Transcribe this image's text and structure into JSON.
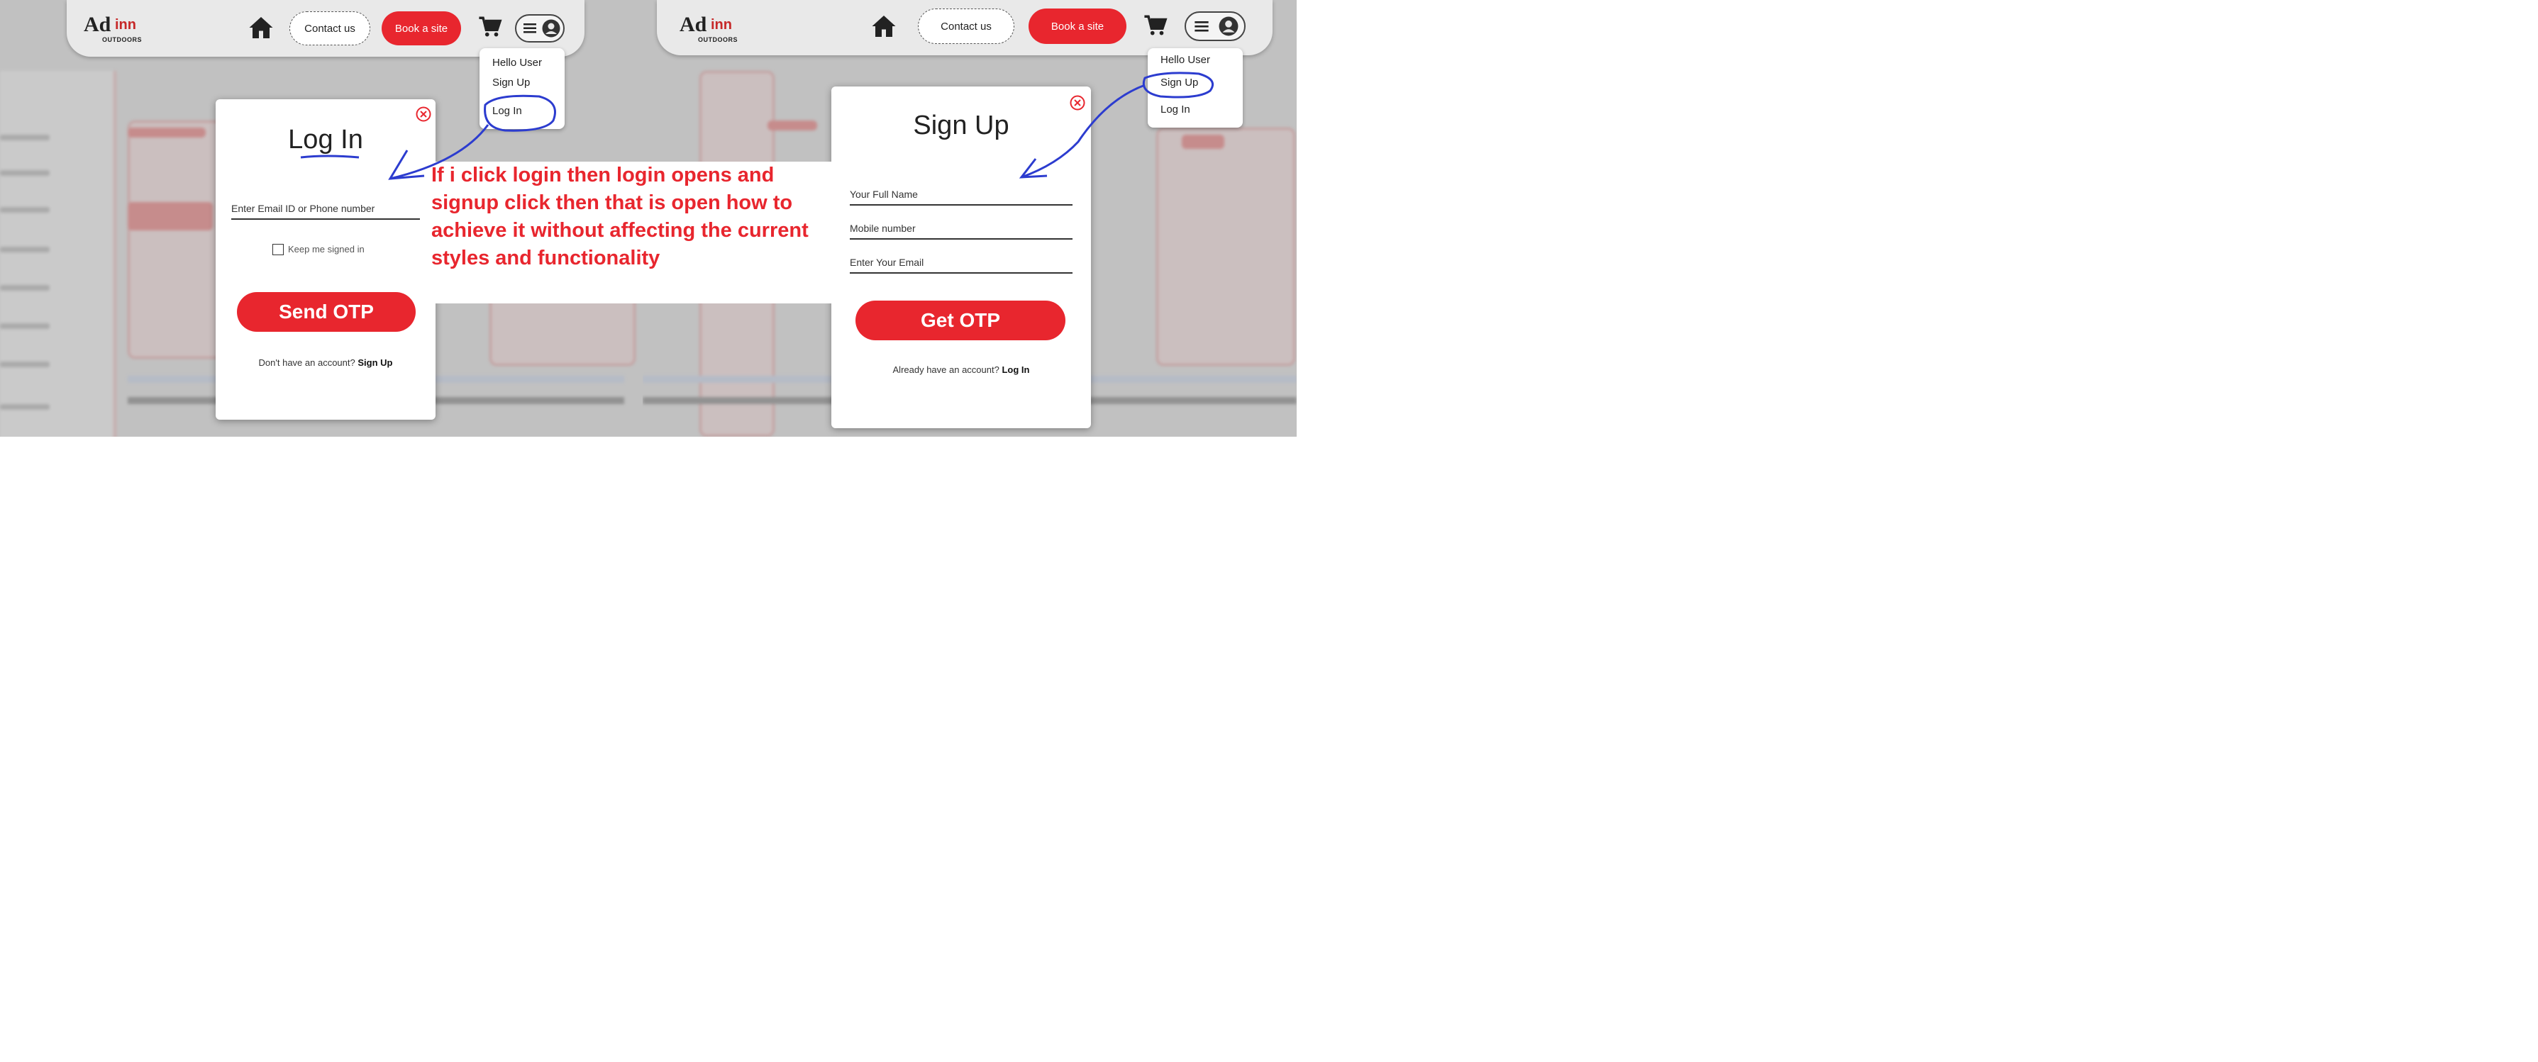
{
  "left_screen": {
    "logo": {
      "ad": "Ad",
      "inn": "inn",
      "sub": "OUTDOORS"
    },
    "nav": {
      "contact_label": "Contact us",
      "book_label": "Book a site"
    },
    "dropdown": {
      "items": [
        "Hello User",
        "Sign Up",
        "Log In"
      ]
    },
    "modal": {
      "title": "Log In",
      "email_placeholder": "Enter Email ID or Phone number",
      "keep_signed_in": "Keep me signed in",
      "submit_label": "Send OTP",
      "footer_text": "Don't have an account?",
      "footer_link": "Sign Up"
    }
  },
  "right_screen": {
    "logo": {
      "ad": "Ad",
      "inn": "inn",
      "sub": "OUTDOORS"
    },
    "nav": {
      "contact_label": "Contact us",
      "book_label": "Book a site"
    },
    "dropdown": {
      "items": [
        "Hello User",
        "Sign Up",
        "Log In"
      ]
    },
    "modal": {
      "title": "Sign Up",
      "fields": [
        "Your Full Name",
        "Mobile number",
        "Enter Your Email"
      ],
      "submit_label": "Get OTP",
      "footer_text": "Already have an account?",
      "footer_link": "Log In"
    }
  },
  "annotation_text": "If i click login then login opens and signup click then that is open how to achieve it without affecting the current styles and functionality",
  "colors": {
    "brand_red": "#e8262e",
    "annotation_ink": "#2c3ccf",
    "navbar_bg": "#e9e9e9"
  }
}
